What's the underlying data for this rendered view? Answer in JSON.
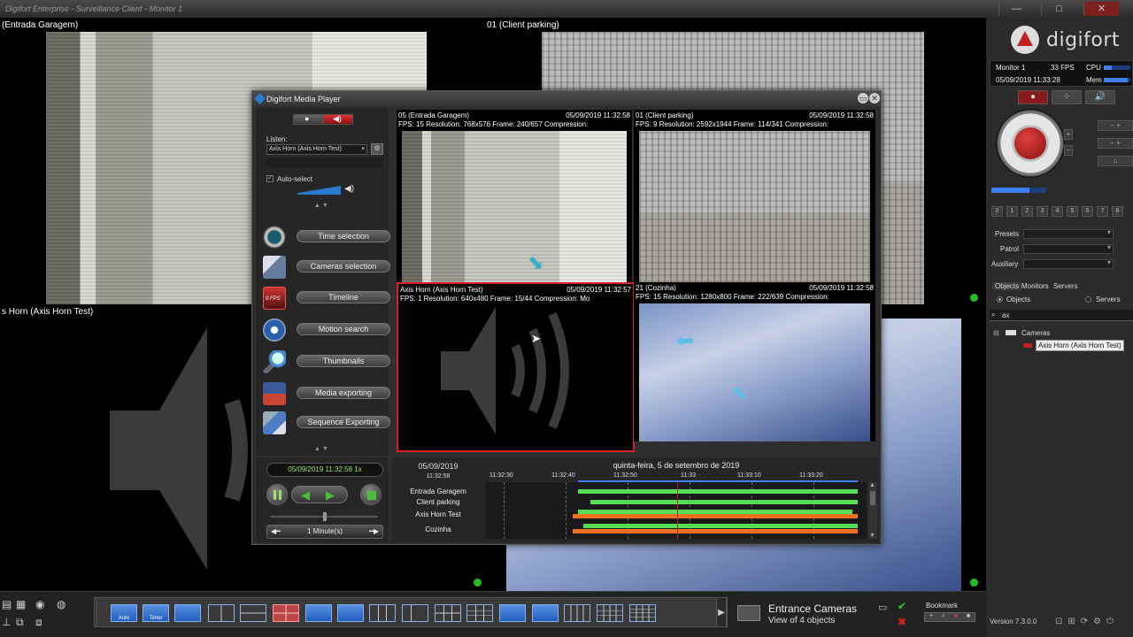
{
  "window": {
    "title": "Digifort Enterprise - Surveillance Client - Monitor 1",
    "controls": [
      "—",
      "□",
      "✕"
    ]
  },
  "cameras": [
    {
      "label": "(Entrada Garagem)"
    },
    {
      "label": "01 (Client parking)"
    },
    {
      "label": "s Horn (Axis Horn Test)"
    }
  ],
  "right_panel": {
    "logo_text": "digifort",
    "monitor": "Monitor 1",
    "fps": "33 FPS",
    "cpu_label": "CPU",
    "datetime": "05/09/2019 11:33:28",
    "mem_label": "Mem",
    "cpu_level": 0.3,
    "mem_level": 0.9,
    "presets_label": "Presets",
    "patrol_label": "Patrol",
    "auxiliary_label": "Auxiliary",
    "preset_numbers": [
      "0",
      "1",
      "2",
      "3",
      "4",
      "5",
      "6",
      "7",
      "8"
    ],
    "tabs": [
      "Objects",
      "Monitors",
      "Servers"
    ],
    "radio_objects": "Objects",
    "radio_servers": "Servers",
    "search_value": "ax",
    "tree_root": "Cameras",
    "tree_item": "Axis Horn (Axis Horn Test)",
    "version": "Version 7.3.0.0"
  },
  "bottom": {
    "mosaic_auto": "Auto",
    "mosaic_timer": "Timer",
    "view_title": "Entrance Cameras",
    "view_subtitle": "View of 4 objects",
    "bookmark_label": "Bookmark"
  },
  "media_player": {
    "title": "Digifort Media Player",
    "listen_label": "Listen:",
    "listen_value": "Axis Horn (Axis Horn Test)",
    "auto_select_label": "Auto-select",
    "menu": [
      {
        "label": "Time selection"
      },
      {
        "label": "Cameras selection"
      },
      {
        "label": "Timeline",
        "icon_text": "0 FPS"
      },
      {
        "label": "Motion search"
      },
      {
        "label": "Thumbnails"
      },
      {
        "label": "Media exporting"
      },
      {
        "label": "Sequence Exporting"
      }
    ],
    "views": [
      {
        "name": "05 (Entrada Garagem)",
        "time": "05/09/2019 11:32:58",
        "info": "FPS: 15   Resolution: 768x576   Frame: 240/657   Compression:"
      },
      {
        "name": "01 (Client parking)",
        "time": "05/09/2019 11:32:58",
        "info": "FPS: 9   Resolution: 2592x1944   Frame: 114/341   Compression:"
      },
      {
        "name": "Axis Horn (Axis Horn Test)",
        "time": "05/09/2019 11:32:57",
        "info": "FPS: 1   Resolution: 640x480   Frame: 15/44   Compression: Mo"
      },
      {
        "name": "21 (Cozinha)",
        "time": "05/09/2019 11:32:58",
        "info": "FPS: 15   Resolution: 1280x800   Frame: 222/639   Compression:"
      }
    ],
    "playback_time": "05/09/2019 11:32:58 1x",
    "zoom": "1 Minute(s)",
    "timeline": {
      "date": "05/09/2019",
      "current": "11:32:58",
      "long_date": "quinta-feira, 5 de setembro de 2019",
      "ticks": [
        "11:32:30",
        "11:32:40",
        "11:32:50",
        "11:33",
        "11:33:10",
        "11:33:20"
      ],
      "tracks": [
        "Entrada Garagem",
        "Client parking",
        "Axis Horn Test",
        "Cozinha"
      ]
    }
  }
}
